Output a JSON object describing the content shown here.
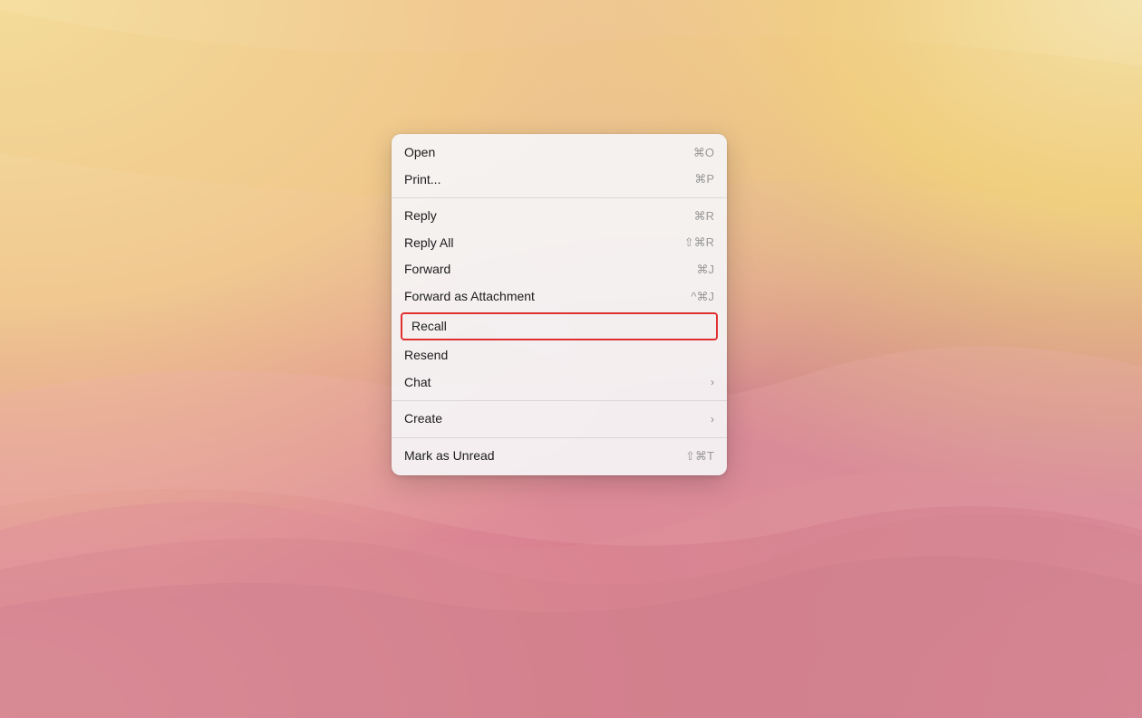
{
  "desktop": {
    "bg_description": "macOS Sonoma wallpaper - warm pink and gold waves"
  },
  "context_menu": {
    "items": [
      {
        "id": "open",
        "label": "Open",
        "shortcut": "⌘O",
        "has_submenu": false,
        "divider_after": false,
        "highlighted": false
      },
      {
        "id": "print",
        "label": "Print...",
        "shortcut": "⌘P",
        "has_submenu": false,
        "divider_after": true,
        "highlighted": false
      },
      {
        "id": "reply",
        "label": "Reply",
        "shortcut": "⌘R",
        "has_submenu": false,
        "divider_after": false,
        "highlighted": false
      },
      {
        "id": "reply-all",
        "label": "Reply All",
        "shortcut": "⇧⌘R",
        "has_submenu": false,
        "divider_after": false,
        "highlighted": false
      },
      {
        "id": "forward",
        "label": "Forward",
        "shortcut": "⌘J",
        "has_submenu": false,
        "divider_after": false,
        "highlighted": false
      },
      {
        "id": "forward-attachment",
        "label": "Forward as Attachment",
        "shortcut": "^⌘J",
        "has_submenu": false,
        "divider_after": false,
        "highlighted": false
      },
      {
        "id": "recall",
        "label": "Recall",
        "shortcut": "",
        "has_submenu": false,
        "divider_after": false,
        "highlighted": true
      },
      {
        "id": "resend",
        "label": "Resend",
        "shortcut": "",
        "has_submenu": false,
        "divider_after": false,
        "highlighted": false
      },
      {
        "id": "chat",
        "label": "Chat",
        "shortcut": "",
        "has_submenu": true,
        "divider_after": true,
        "highlighted": false
      },
      {
        "id": "create",
        "label": "Create",
        "shortcut": "",
        "has_submenu": true,
        "divider_after": true,
        "highlighted": false
      },
      {
        "id": "mark-unread",
        "label": "Mark as Unread",
        "shortcut": "⇧⌘T",
        "has_submenu": false,
        "divider_after": false,
        "highlighted": false
      }
    ]
  }
}
